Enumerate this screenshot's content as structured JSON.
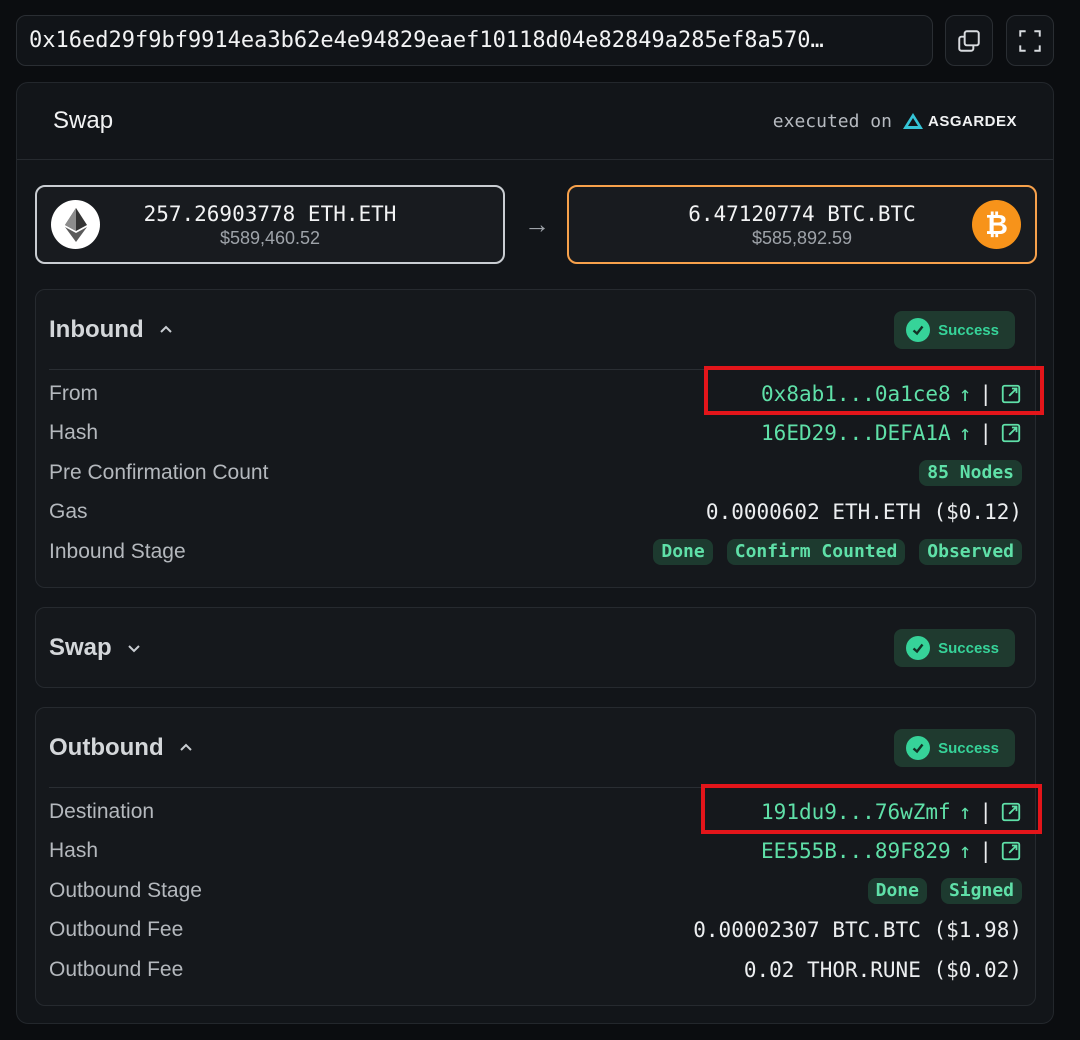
{
  "tx_hash": "0x16ed29f9bf9914ea3b62e4e94829eaef10118d04e82849a285ef8a570…",
  "header": {
    "title": "Swap",
    "executed_on": "executed on",
    "brand": "ASGARDEX"
  },
  "from_asset": {
    "amount": "257.26903778 ETH.ETH",
    "usd": "$589,460.52",
    "icon": "ethereum-icon"
  },
  "to_asset": {
    "amount": "6.47120774 BTC.BTC",
    "usd": "$585,892.59",
    "icon": "bitcoin-icon",
    "symbol": "₿"
  },
  "arrow": "→",
  "inbound": {
    "title": "Inbound",
    "status": "Success",
    "rows": {
      "from_label": "From",
      "from_value": "0x8ab1...0a1ce8",
      "hash_label": "Hash",
      "hash_value": "16ED29...DEFA1A",
      "preconf_label": "Pre Confirmation Count",
      "preconf_value": "85 Nodes",
      "gas_label": "Gas",
      "gas_value": "0.0000602 ETH.ETH ($0.12)",
      "stage_label": "Inbound Stage",
      "stage_pills": [
        "Done",
        "Confirm Counted",
        "Observed"
      ]
    }
  },
  "swap": {
    "title": "Swap",
    "status": "Success"
  },
  "outbound": {
    "title": "Outbound",
    "status": "Success",
    "rows": {
      "dest_label": "Destination",
      "dest_value": "191du9...76wZmf",
      "hash_label": "Hash",
      "hash_value": "EE555B...89F829",
      "stage_label": "Outbound Stage",
      "stage_pills": [
        "Done",
        "Signed"
      ],
      "fee1_label": "Outbound Fee",
      "fee1_value": "0.00002307 BTC.BTC ($1.98)",
      "fee2_label": "Outbound Fee",
      "fee2_value": "0.02 THOR.RUNE ($0.02)"
    }
  },
  "link_suffix": "↑",
  "link_sep": "|",
  "colors": {
    "success": "#36d399",
    "link": "#5fe0a8",
    "eth_border": "#c9cdd2",
    "btc_border": "#f7a14b",
    "highlight": "#e3151a"
  }
}
